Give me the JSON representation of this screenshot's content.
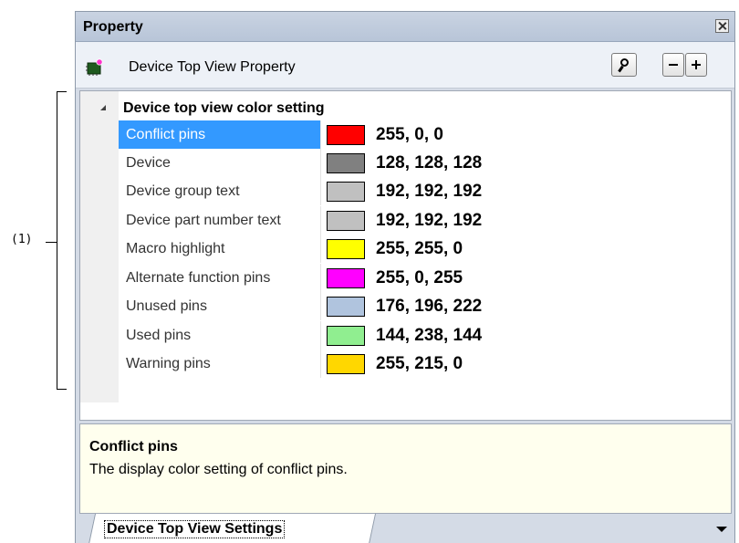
{
  "callout": {
    "label": "(1)"
  },
  "panel": {
    "title": "Property"
  },
  "toolbar": {
    "label": "Device Top View Property",
    "chip_icon": "chip-icon",
    "search_icon": "search-icon",
    "collapse_label": "−",
    "expand_label": "+"
  },
  "grid": {
    "category": "Device top view color setting",
    "rows": [
      {
        "name": "Conflict pins",
        "color": "#ff0000",
        "value": "255, 0, 0",
        "selected": true
      },
      {
        "name": "Device",
        "color": "#808080",
        "value": "128, 128, 128",
        "selected": false
      },
      {
        "name": "Device group text",
        "color": "#c0c0c0",
        "value": "192, 192, 192",
        "selected": false
      },
      {
        "name": "Device part number text",
        "color": "#c0c0c0",
        "value": "192, 192, 192",
        "selected": false
      },
      {
        "name": "Macro highlight",
        "color": "#ffff00",
        "value": "255, 255, 0",
        "selected": false
      },
      {
        "name": "Alternate function pins",
        "color": "#ff00ff",
        "value": "255, 0, 255",
        "selected": false
      },
      {
        "name": "Unused pins",
        "color": "#b0c4de",
        "value": "176, 196, 222",
        "selected": false
      },
      {
        "name": "Used pins",
        "color": "#90ee90",
        "value": "144, 238, 144",
        "selected": false
      },
      {
        "name": "Warning pins",
        "color": "#ffd700",
        "value": "255, 215, 0",
        "selected": false
      }
    ]
  },
  "description": {
    "title": "Conflict pins",
    "text": "The display color setting of conflict pins."
  },
  "tabs": [
    {
      "label": "Device Top View Settings"
    }
  ]
}
